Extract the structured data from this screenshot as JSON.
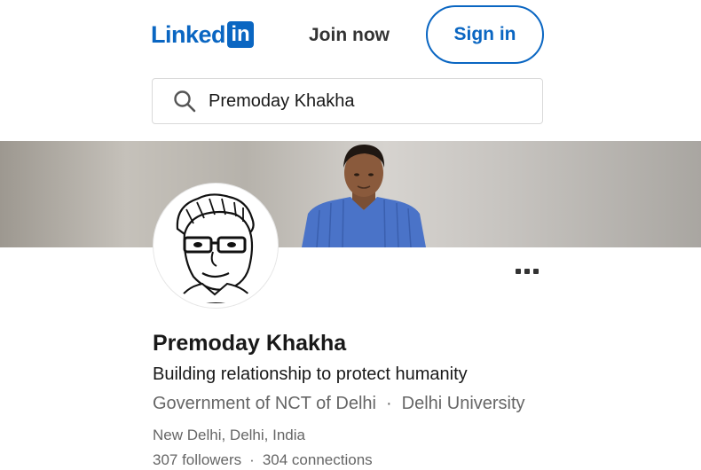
{
  "header": {
    "logo_text": "Linked",
    "logo_box_text": "in",
    "join_label": "Join now",
    "signin_label": "Sign in"
  },
  "search": {
    "value": "Premoday Khakha",
    "icon": "search-icon"
  },
  "profile": {
    "name": "Premoday Khakha",
    "headline": "Building relationship to protect humanity",
    "organization": "Government of NCT of Delhi",
    "education": "Delhi University",
    "location": "New Delhi, Delhi, India",
    "followers": "307 followers",
    "connections": "304 connections",
    "more_icon": "more-horizontal-icon"
  },
  "colors": {
    "brand": "#0a66c2",
    "text_primary": "#191919",
    "text_secondary": "#666666"
  }
}
